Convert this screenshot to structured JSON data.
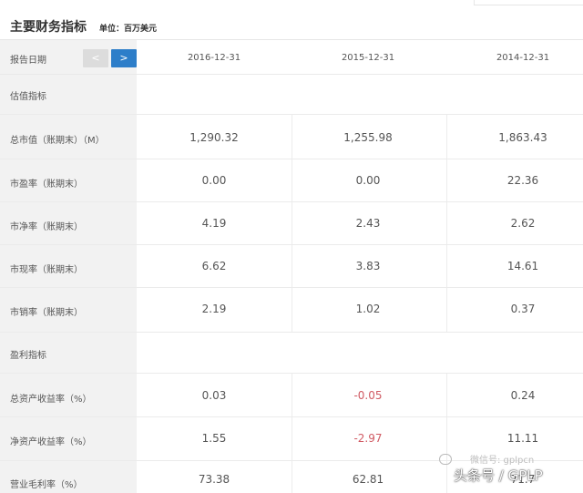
{
  "header": {
    "title": "主要财务指标",
    "unit": "单位：百万美元"
  },
  "date_header": {
    "label": "报告日期",
    "prev_label": "<",
    "next_label": ">",
    "dates": [
      "2016-12-31",
      "2015-12-31",
      "2014-12-31"
    ]
  },
  "sections": {
    "valuation": "估值指标",
    "profit": "盈利指标"
  },
  "rows": [
    {
      "label": "总市值（账期末）（M）",
      "values": [
        "1,290.32",
        "1,255.98",
        "1,863.43"
      ]
    },
    {
      "label": "市盈率（账期末）",
      "values": [
        "0.00",
        "0.00",
        "22.36"
      ]
    },
    {
      "label": "市净率（账期末）",
      "values": [
        "4.19",
        "2.43",
        "2.62"
      ]
    },
    {
      "label": "市现率（账期末）",
      "values": [
        "6.62",
        "3.83",
        "14.61"
      ]
    },
    {
      "label": "市销率（账期末）",
      "values": [
        "2.19",
        "1.02",
        "0.37"
      ]
    },
    {
      "label": "总资产收益率（%）",
      "values": [
        "0.03",
        "-0.05",
        "0.24"
      ]
    },
    {
      "label": "净资产收益率（%）",
      "values": [
        "1.55",
        "-2.97",
        "11.11"
      ]
    },
    {
      "label": "营业毛利率（%）",
      "values": [
        "73.38",
        "62.81",
        "71.7"
      ]
    }
  ],
  "watermark": {
    "sub": "微信号: gplpcn",
    "main": "头条号 / GPLP"
  },
  "colors": {
    "accent": "#2d7ec9",
    "negative": "#d05a63",
    "label_bg": "#f2f2f2"
  }
}
